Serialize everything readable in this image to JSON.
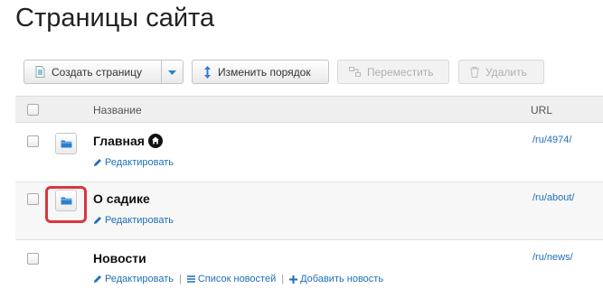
{
  "page": {
    "title": "Страницы сайта"
  },
  "toolbar": {
    "create_label": "Создать страницу",
    "order_label": "Изменить порядок",
    "move_label": "Переместить",
    "delete_label": "Удалить"
  },
  "table": {
    "col_name": "Название",
    "col_url": "URL",
    "rows": [
      {
        "title": "Главная",
        "edit": "Редактировать",
        "url": "/ru/4974/",
        "is_home": true
      },
      {
        "title": "О садике",
        "edit": "Редактировать",
        "url": "/ru/about/"
      },
      {
        "title": "Новости",
        "edit": "Редактировать",
        "list": "Список новостей",
        "add": "Добавить новость",
        "url": "/ru/news/"
      }
    ]
  },
  "colors": {
    "link": "#1e6fb8",
    "highlight": "#d9363e",
    "folder": "#2a7fd0"
  }
}
